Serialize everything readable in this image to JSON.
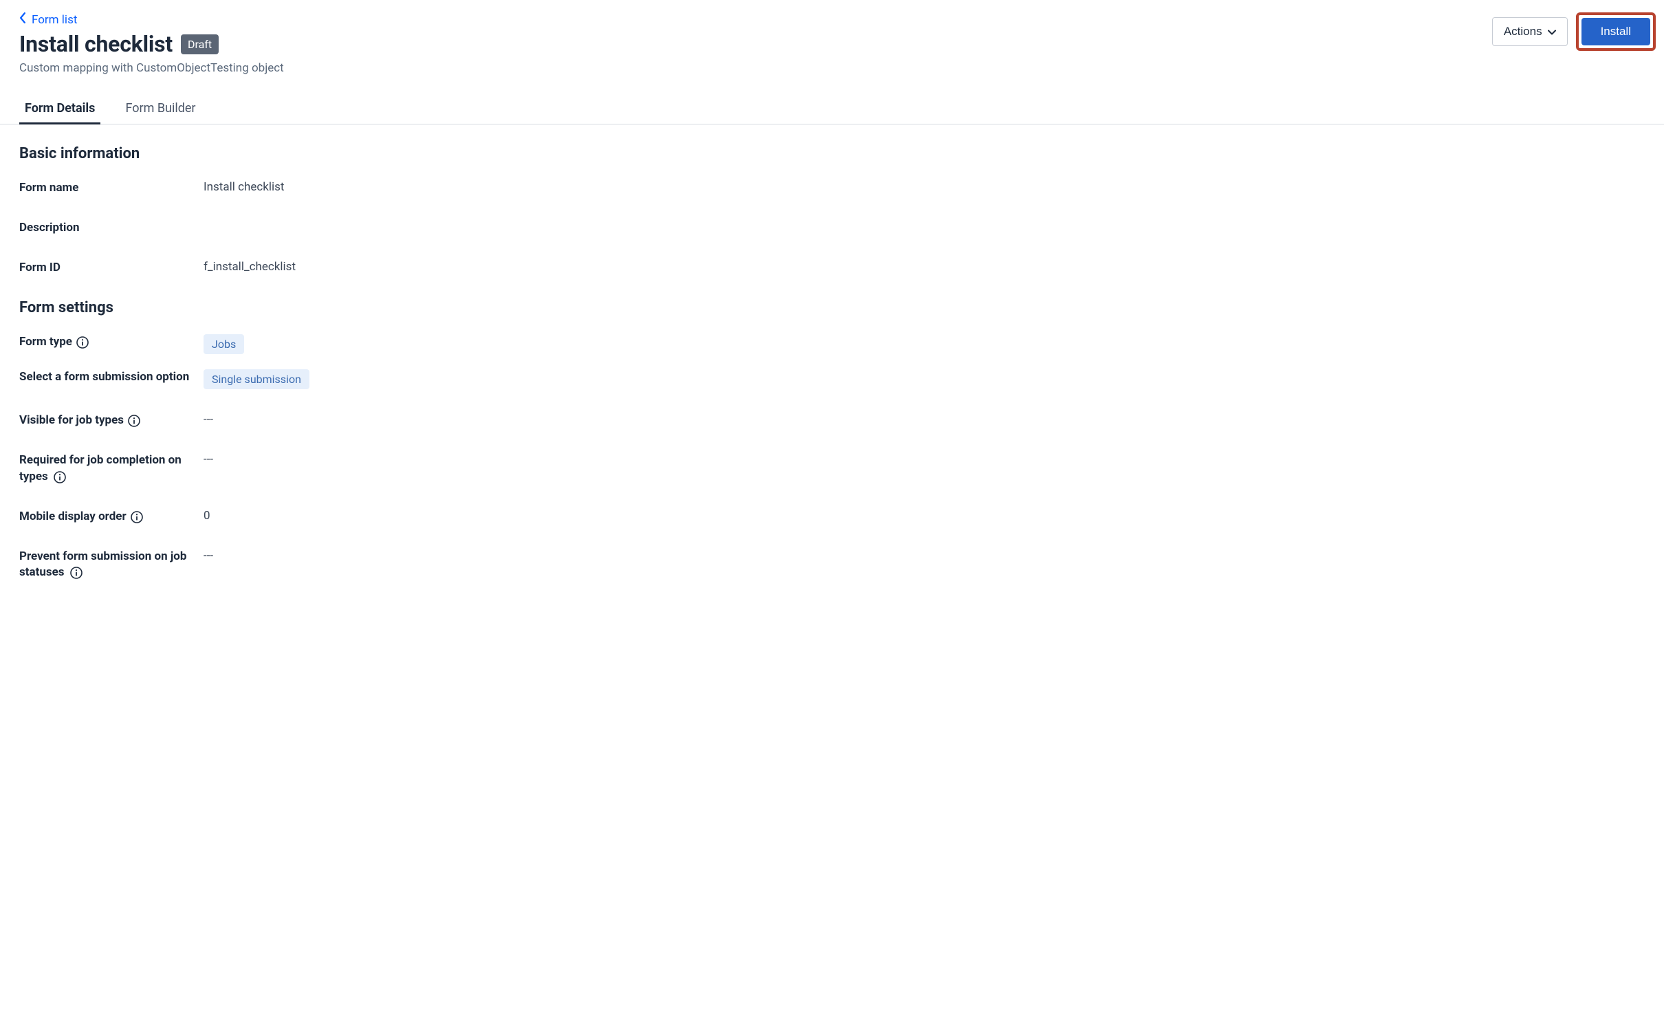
{
  "header": {
    "backLink": "Form list",
    "title": "Install checklist",
    "badge": "Draft",
    "subtitle": "Custom mapping with CustomObjectTesting object",
    "actionsLabel": "Actions",
    "installLabel": "Install"
  },
  "tabs": [
    {
      "label": "Form Details",
      "active": true
    },
    {
      "label": "Form Builder",
      "active": false
    }
  ],
  "sections": {
    "basicInfo": {
      "title": "Basic information",
      "fields": {
        "formName": {
          "label": "Form name",
          "value": "Install checklist"
        },
        "description": {
          "label": "Description",
          "value": ""
        },
        "formId": {
          "label": "Form ID",
          "value": "f_install_checklist"
        }
      }
    },
    "formSettings": {
      "title": "Form settings",
      "fields": {
        "formType": {
          "label": "Form type",
          "value": "Jobs",
          "hasInfo": true
        },
        "submissionOption": {
          "label": "Select a form submission option",
          "value": "Single submission"
        },
        "visibleJobTypes": {
          "label": "Visible for job types",
          "value": "---",
          "hasInfo": true
        },
        "requiredJobCompletion": {
          "label": "Required for job completion on types",
          "value": "---",
          "hasInfo": true
        },
        "mobileDisplayOrder": {
          "label": "Mobile display order",
          "value": "0",
          "hasInfo": true
        },
        "preventSubmission": {
          "label": "Prevent form submission on job statuses",
          "value": "---",
          "hasInfo": true
        }
      }
    }
  }
}
